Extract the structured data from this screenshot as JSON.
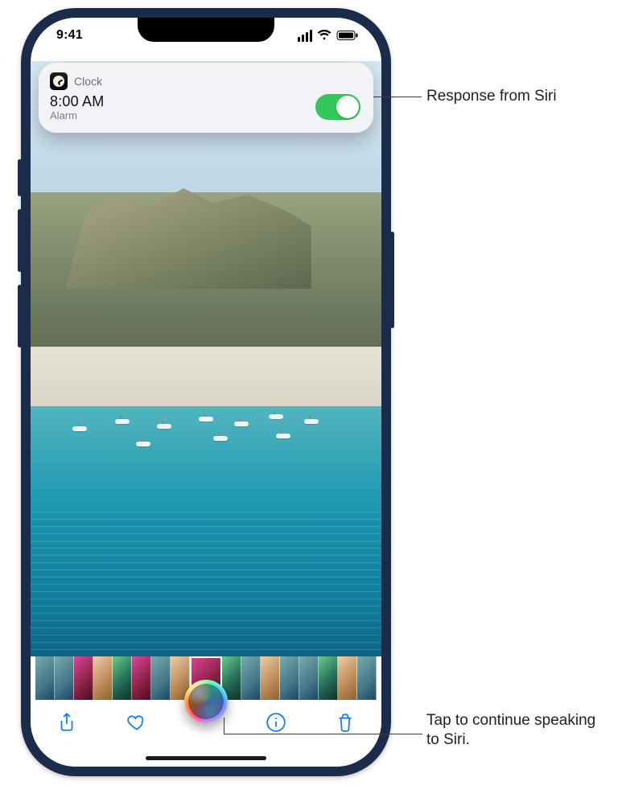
{
  "statusbar": {
    "time": "9:41"
  },
  "siri_card": {
    "app_name": "Clock",
    "time": "8:00 AM",
    "sub": "Alarm",
    "toggle_on": true
  },
  "toolbar": {
    "share": "share-icon",
    "favorite": "heart-icon",
    "info": "info-icon",
    "delete": "trash-icon"
  },
  "callouts": {
    "response": "Response from Siri",
    "tap": "Tap to continue speaking to Siri."
  }
}
